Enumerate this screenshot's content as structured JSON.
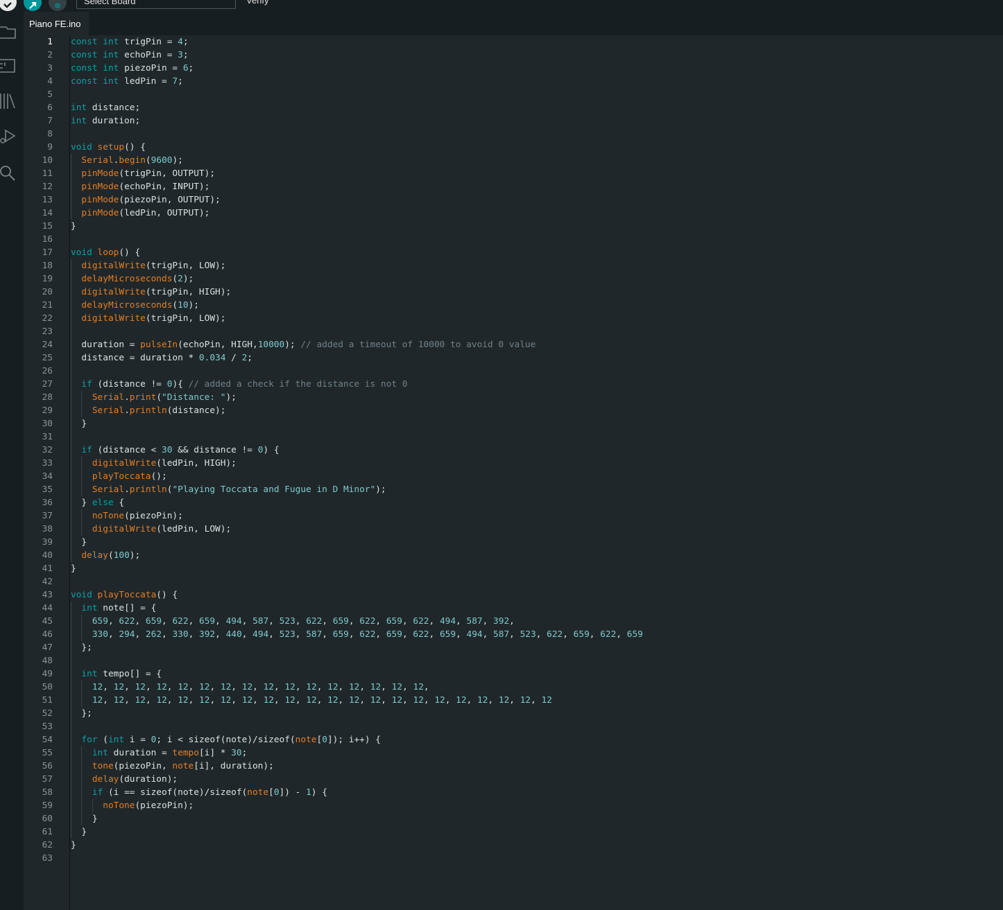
{
  "toolbar": {
    "board_placeholder": "Select Board",
    "hover_label": "Verify"
  },
  "file_tab": {
    "name": "Piano FE.ino"
  },
  "editor": {
    "current_line": 1,
    "colors": {
      "text": "#dae3e3",
      "keyword": "#0ca1a6",
      "function": "#e67e22",
      "number": "#7fcbcd",
      "string": "#7fcbcd",
      "comment": "#72808a",
      "line_number": "#8a9497",
      "line_number_active": "#ffffff"
    },
    "lines": [
      [
        {
          "t": "const",
          "c": "k"
        },
        {
          "t": " "
        },
        {
          "t": "int",
          "c": "k"
        },
        {
          "t": " trigPin = "
        },
        {
          "t": "4",
          "c": "n"
        },
        {
          "t": ";"
        }
      ],
      [
        {
          "t": "const",
          "c": "k"
        },
        {
          "t": " "
        },
        {
          "t": "int",
          "c": "k"
        },
        {
          "t": " echoPin = "
        },
        {
          "t": "3",
          "c": "n"
        },
        {
          "t": ";"
        }
      ],
      [
        {
          "t": "const",
          "c": "k"
        },
        {
          "t": " "
        },
        {
          "t": "int",
          "c": "k"
        },
        {
          "t": " piezoPin = "
        },
        {
          "t": "6",
          "c": "n"
        },
        {
          "t": ";"
        }
      ],
      [
        {
          "t": "const",
          "c": "k"
        },
        {
          "t": " "
        },
        {
          "t": "int",
          "c": "k"
        },
        {
          "t": " ledPin = "
        },
        {
          "t": "7",
          "c": "n"
        },
        {
          "t": ";"
        }
      ],
      [],
      [
        {
          "t": "int",
          "c": "k"
        },
        {
          "t": " distance;"
        }
      ],
      [
        {
          "t": "int",
          "c": "k"
        },
        {
          "t": " duration;"
        }
      ],
      [],
      [
        {
          "t": "void",
          "c": "k"
        },
        {
          "t": " "
        },
        {
          "t": "setup",
          "c": "f"
        },
        {
          "t": "() {"
        }
      ],
      [
        {
          "t": "  "
        },
        {
          "t": "Serial",
          "c": "f"
        },
        {
          "t": "."
        },
        {
          "t": "begin",
          "c": "f"
        },
        {
          "t": "("
        },
        {
          "t": "9600",
          "c": "n"
        },
        {
          "t": ");"
        }
      ],
      [
        {
          "t": "  "
        },
        {
          "t": "pinMode",
          "c": "f"
        },
        {
          "t": "(trigPin, OUTPUT);"
        }
      ],
      [
        {
          "t": "  "
        },
        {
          "t": "pinMode",
          "c": "f"
        },
        {
          "t": "(echoPin, INPUT);"
        }
      ],
      [
        {
          "t": "  "
        },
        {
          "t": "pinMode",
          "c": "f"
        },
        {
          "t": "(piezoPin, OUTPUT);"
        }
      ],
      [
        {
          "t": "  "
        },
        {
          "t": "pinMode",
          "c": "f"
        },
        {
          "t": "(ledPin, OUTPUT);"
        }
      ],
      [
        {
          "t": "}"
        }
      ],
      [],
      [
        {
          "t": "void",
          "c": "k"
        },
        {
          "t": " "
        },
        {
          "t": "loop",
          "c": "f"
        },
        {
          "t": "() {"
        }
      ],
      [
        {
          "t": "  "
        },
        {
          "t": "digitalWrite",
          "c": "f"
        },
        {
          "t": "(trigPin, LOW);"
        }
      ],
      [
        {
          "t": "  "
        },
        {
          "t": "delayMicroseconds",
          "c": "f"
        },
        {
          "t": "("
        },
        {
          "t": "2",
          "c": "n"
        },
        {
          "t": ");"
        }
      ],
      [
        {
          "t": "  "
        },
        {
          "t": "digitalWrite",
          "c": "f"
        },
        {
          "t": "(trigPin, HIGH);"
        }
      ],
      [
        {
          "t": "  "
        },
        {
          "t": "delayMicroseconds",
          "c": "f"
        },
        {
          "t": "("
        },
        {
          "t": "10",
          "c": "n"
        },
        {
          "t": ");"
        }
      ],
      [
        {
          "t": "  "
        },
        {
          "t": "digitalWrite",
          "c": "f"
        },
        {
          "t": "(trigPin, LOW);"
        }
      ],
      [],
      [
        {
          "t": "  duration = "
        },
        {
          "t": "pulseIn",
          "c": "f"
        },
        {
          "t": "(echoPin, HIGH,"
        },
        {
          "t": "10000",
          "c": "n"
        },
        {
          "t": "); "
        },
        {
          "t": "// added a timeout of 10000 to avoid 0 value",
          "c": "c"
        }
      ],
      [
        {
          "t": "  distance = duration * "
        },
        {
          "t": "0.034",
          "c": "n"
        },
        {
          "t": " / "
        },
        {
          "t": "2",
          "c": "n"
        },
        {
          "t": ";"
        }
      ],
      [],
      [
        {
          "t": "  "
        },
        {
          "t": "if",
          "c": "k"
        },
        {
          "t": " (distance != "
        },
        {
          "t": "0",
          "c": "n"
        },
        {
          "t": "){ "
        },
        {
          "t": "// added a check if the distance is not 0",
          "c": "c"
        }
      ],
      [
        {
          "t": "    "
        },
        {
          "t": "Serial",
          "c": "f"
        },
        {
          "t": "."
        },
        {
          "t": "print",
          "c": "f"
        },
        {
          "t": "("
        },
        {
          "t": "\"Distance: \"",
          "c": "s"
        },
        {
          "t": ");"
        }
      ],
      [
        {
          "t": "    "
        },
        {
          "t": "Serial",
          "c": "f"
        },
        {
          "t": "."
        },
        {
          "t": "println",
          "c": "f"
        },
        {
          "t": "(distance);"
        }
      ],
      [
        {
          "t": "  }"
        }
      ],
      [],
      [
        {
          "t": "  "
        },
        {
          "t": "if",
          "c": "k"
        },
        {
          "t": " (distance < "
        },
        {
          "t": "30",
          "c": "n"
        },
        {
          "t": " && distance != "
        },
        {
          "t": "0",
          "c": "n"
        },
        {
          "t": ") {"
        }
      ],
      [
        {
          "t": "    "
        },
        {
          "t": "digitalWrite",
          "c": "f"
        },
        {
          "t": "(ledPin, HIGH);"
        }
      ],
      [
        {
          "t": "    "
        },
        {
          "t": "playToccata",
          "c": "f"
        },
        {
          "t": "();"
        }
      ],
      [
        {
          "t": "    "
        },
        {
          "t": "Serial",
          "c": "f"
        },
        {
          "t": "."
        },
        {
          "t": "println",
          "c": "f"
        },
        {
          "t": "("
        },
        {
          "t": "\"Playing Toccata and Fugue in D Minor\"",
          "c": "s"
        },
        {
          "t": ");"
        }
      ],
      [
        {
          "t": "  } "
        },
        {
          "t": "else",
          "c": "k"
        },
        {
          "t": " {"
        }
      ],
      [
        {
          "t": "    "
        },
        {
          "t": "noTone",
          "c": "f"
        },
        {
          "t": "(piezoPin);"
        }
      ],
      [
        {
          "t": "    "
        },
        {
          "t": "digitalWrite",
          "c": "f"
        },
        {
          "t": "(ledPin, LOW);"
        }
      ],
      [
        {
          "t": "  }"
        }
      ],
      [
        {
          "t": "  "
        },
        {
          "t": "delay",
          "c": "f"
        },
        {
          "t": "("
        },
        {
          "t": "100",
          "c": "n"
        },
        {
          "t": ");"
        }
      ],
      [
        {
          "t": "}"
        }
      ],
      [],
      [
        {
          "t": "void",
          "c": "k"
        },
        {
          "t": " "
        },
        {
          "t": "playToccata",
          "c": "f"
        },
        {
          "t": "() {"
        }
      ],
      [
        {
          "t": "  "
        },
        {
          "t": "int",
          "c": "k"
        },
        {
          "t": " note[] = {"
        }
      ],
      [
        {
          "t": "    "
        },
        {
          "t": "659",
          "c": "n"
        },
        {
          "t": ", "
        },
        {
          "t": "622",
          "c": "n"
        },
        {
          "t": ", "
        },
        {
          "t": "659",
          "c": "n"
        },
        {
          "t": ", "
        },
        {
          "t": "622",
          "c": "n"
        },
        {
          "t": ", "
        },
        {
          "t": "659",
          "c": "n"
        },
        {
          "t": ", "
        },
        {
          "t": "494",
          "c": "n"
        },
        {
          "t": ", "
        },
        {
          "t": "587",
          "c": "n"
        },
        {
          "t": ", "
        },
        {
          "t": "523",
          "c": "n"
        },
        {
          "t": ", "
        },
        {
          "t": "622",
          "c": "n"
        },
        {
          "t": ", "
        },
        {
          "t": "659",
          "c": "n"
        },
        {
          "t": ", "
        },
        {
          "t": "622",
          "c": "n"
        },
        {
          "t": ", "
        },
        {
          "t": "659",
          "c": "n"
        },
        {
          "t": ", "
        },
        {
          "t": "622",
          "c": "n"
        },
        {
          "t": ", "
        },
        {
          "t": "494",
          "c": "n"
        },
        {
          "t": ", "
        },
        {
          "t": "587",
          "c": "n"
        },
        {
          "t": ", "
        },
        {
          "t": "392",
          "c": "n"
        },
        {
          "t": ","
        }
      ],
      [
        {
          "t": "    "
        },
        {
          "t": "330",
          "c": "n"
        },
        {
          "t": ", "
        },
        {
          "t": "294",
          "c": "n"
        },
        {
          "t": ", "
        },
        {
          "t": "262",
          "c": "n"
        },
        {
          "t": ", "
        },
        {
          "t": "330",
          "c": "n"
        },
        {
          "t": ", "
        },
        {
          "t": "392",
          "c": "n"
        },
        {
          "t": ", "
        },
        {
          "t": "440",
          "c": "n"
        },
        {
          "t": ", "
        },
        {
          "t": "494",
          "c": "n"
        },
        {
          "t": ", "
        },
        {
          "t": "523",
          "c": "n"
        },
        {
          "t": ", "
        },
        {
          "t": "587",
          "c": "n"
        },
        {
          "t": ", "
        },
        {
          "t": "659",
          "c": "n"
        },
        {
          "t": ", "
        },
        {
          "t": "622",
          "c": "n"
        },
        {
          "t": ", "
        },
        {
          "t": "659",
          "c": "n"
        },
        {
          "t": ", "
        },
        {
          "t": "622",
          "c": "n"
        },
        {
          "t": ", "
        },
        {
          "t": "659",
          "c": "n"
        },
        {
          "t": ", "
        },
        {
          "t": "494",
          "c": "n"
        },
        {
          "t": ", "
        },
        {
          "t": "587",
          "c": "n"
        },
        {
          "t": ", "
        },
        {
          "t": "523",
          "c": "n"
        },
        {
          "t": ", "
        },
        {
          "t": "622",
          "c": "n"
        },
        {
          "t": ", "
        },
        {
          "t": "659",
          "c": "n"
        },
        {
          "t": ", "
        },
        {
          "t": "622",
          "c": "n"
        },
        {
          "t": ", "
        },
        {
          "t": "659",
          "c": "n"
        }
      ],
      [
        {
          "t": "  };"
        }
      ],
      [],
      [
        {
          "t": "  "
        },
        {
          "t": "int",
          "c": "k"
        },
        {
          "t": " tempo[] = {"
        }
      ],
      [
        {
          "t": "    "
        },
        {
          "t": "12",
          "c": "n"
        },
        {
          "t": ", "
        },
        {
          "t": "12",
          "c": "n"
        },
        {
          "t": ", "
        },
        {
          "t": "12",
          "c": "n"
        },
        {
          "t": ", "
        },
        {
          "t": "12",
          "c": "n"
        },
        {
          "t": ", "
        },
        {
          "t": "12",
          "c": "n"
        },
        {
          "t": ", "
        },
        {
          "t": "12",
          "c": "n"
        },
        {
          "t": ", "
        },
        {
          "t": "12",
          "c": "n"
        },
        {
          "t": ", "
        },
        {
          "t": "12",
          "c": "n"
        },
        {
          "t": ", "
        },
        {
          "t": "12",
          "c": "n"
        },
        {
          "t": ", "
        },
        {
          "t": "12",
          "c": "n"
        },
        {
          "t": ", "
        },
        {
          "t": "12",
          "c": "n"
        },
        {
          "t": ", "
        },
        {
          "t": "12",
          "c": "n"
        },
        {
          "t": ", "
        },
        {
          "t": "12",
          "c": "n"
        },
        {
          "t": ", "
        },
        {
          "t": "12",
          "c": "n"
        },
        {
          "t": ", "
        },
        {
          "t": "12",
          "c": "n"
        },
        {
          "t": ", "
        },
        {
          "t": "12",
          "c": "n"
        },
        {
          "t": ","
        }
      ],
      [
        {
          "t": "    "
        },
        {
          "t": "12",
          "c": "n"
        },
        {
          "t": ", "
        },
        {
          "t": "12",
          "c": "n"
        },
        {
          "t": ", "
        },
        {
          "t": "12",
          "c": "n"
        },
        {
          "t": ", "
        },
        {
          "t": "12",
          "c": "n"
        },
        {
          "t": ", "
        },
        {
          "t": "12",
          "c": "n"
        },
        {
          "t": ", "
        },
        {
          "t": "12",
          "c": "n"
        },
        {
          "t": ", "
        },
        {
          "t": "12",
          "c": "n"
        },
        {
          "t": ", "
        },
        {
          "t": "12",
          "c": "n"
        },
        {
          "t": ", "
        },
        {
          "t": "12",
          "c": "n"
        },
        {
          "t": ", "
        },
        {
          "t": "12",
          "c": "n"
        },
        {
          "t": ", "
        },
        {
          "t": "12",
          "c": "n"
        },
        {
          "t": ", "
        },
        {
          "t": "12",
          "c": "n"
        },
        {
          "t": ", "
        },
        {
          "t": "12",
          "c": "n"
        },
        {
          "t": ", "
        },
        {
          "t": "12",
          "c": "n"
        },
        {
          "t": ", "
        },
        {
          "t": "12",
          "c": "n"
        },
        {
          "t": ", "
        },
        {
          "t": "12",
          "c": "n"
        },
        {
          "t": ", "
        },
        {
          "t": "12",
          "c": "n"
        },
        {
          "t": ", "
        },
        {
          "t": "12",
          "c": "n"
        },
        {
          "t": ", "
        },
        {
          "t": "12",
          "c": "n"
        },
        {
          "t": ", "
        },
        {
          "t": "12",
          "c": "n"
        },
        {
          "t": ", "
        },
        {
          "t": "12",
          "c": "n"
        },
        {
          "t": ", "
        },
        {
          "t": "12",
          "c": "n"
        }
      ],
      [
        {
          "t": "  };"
        }
      ],
      [],
      [
        {
          "t": "  "
        },
        {
          "t": "for",
          "c": "k"
        },
        {
          "t": " ("
        },
        {
          "t": "int",
          "c": "k"
        },
        {
          "t": " i = "
        },
        {
          "t": "0",
          "c": "n"
        },
        {
          "t": "; i < sizeof(note)/sizeof("
        },
        {
          "t": "note",
          "c": "f"
        },
        {
          "t": "["
        },
        {
          "t": "0",
          "c": "n"
        },
        {
          "t": "]); i++) {"
        }
      ],
      [
        {
          "t": "    "
        },
        {
          "t": "int",
          "c": "k"
        },
        {
          "t": " duration = "
        },
        {
          "t": "tempo",
          "c": "f"
        },
        {
          "t": "[i] * "
        },
        {
          "t": "30",
          "c": "n"
        },
        {
          "t": ";"
        }
      ],
      [
        {
          "t": "    "
        },
        {
          "t": "tone",
          "c": "f"
        },
        {
          "t": "(piezoPin, "
        },
        {
          "t": "note",
          "c": "f"
        },
        {
          "t": "[i], duration);"
        }
      ],
      [
        {
          "t": "    "
        },
        {
          "t": "delay",
          "c": "f"
        },
        {
          "t": "(duration);"
        }
      ],
      [
        {
          "t": "    "
        },
        {
          "t": "if",
          "c": "k"
        },
        {
          "t": " (i == sizeof(note)/sizeof("
        },
        {
          "t": "note",
          "c": "f"
        },
        {
          "t": "["
        },
        {
          "t": "0",
          "c": "n"
        },
        {
          "t": "]) - "
        },
        {
          "t": "1",
          "c": "n"
        },
        {
          "t": ") {"
        }
      ],
      [
        {
          "t": "      "
        },
        {
          "t": "noTone",
          "c": "f"
        },
        {
          "t": "(piezoPin);"
        }
      ],
      [
        {
          "t": "    }"
        }
      ],
      [
        {
          "t": "  }"
        }
      ],
      [
        {
          "t": "}"
        }
      ],
      []
    ]
  }
}
